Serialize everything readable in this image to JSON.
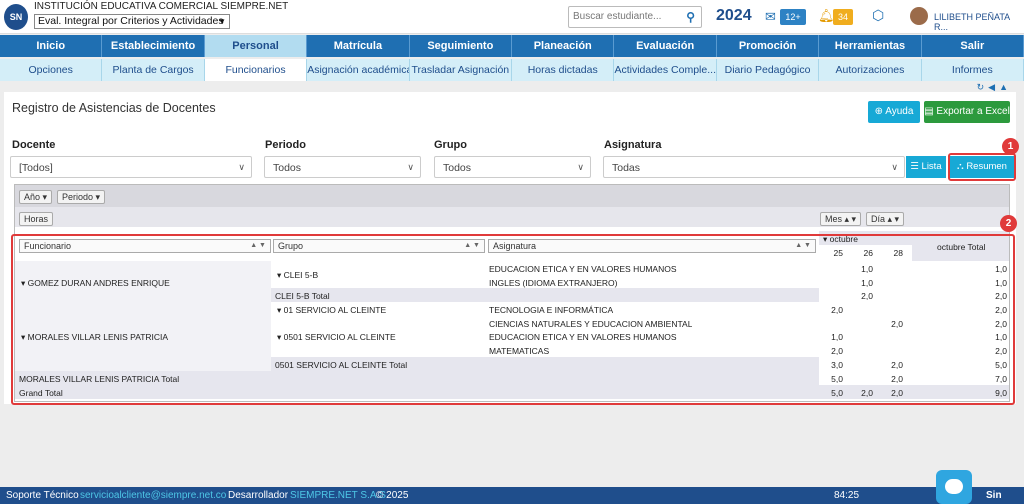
{
  "header": {
    "logo": "SN",
    "institution": "INSTITUCIÓN EDUCATIVA COMERCIAL SIEMPRE.NET",
    "eval_select": "Eval. Integral por Criterios y Actividades",
    "search_placeholder": "Buscar estudiante...",
    "year": "2024",
    "mail_badge": "12+",
    "bell_badge": "34",
    "user_name": "LILIBETH PEÑATA R..."
  },
  "nav_main": [
    "Inicio",
    "Establecimiento",
    "Personal",
    "Matrícula",
    "Seguimiento",
    "Planeación",
    "Evaluación",
    "Promoción",
    "Herramientas",
    "Salir"
  ],
  "nav_sub": [
    "Opciones",
    "Planta de Cargos",
    "Funcionarios",
    "Asignación académica",
    "Trasladar Asignación",
    "Horas dictadas",
    "Actividades Comple... ▾",
    "Diario Pedagógico",
    "Autorizaciones",
    "Informes"
  ],
  "page": {
    "title": "Registro de Asistencias de Docentes",
    "btn_help": "Ayuda",
    "btn_excel": "Exportar a Excel"
  },
  "filters": {
    "docente_label": "Docente",
    "docente_value": "[Todos]",
    "periodo_label": "Periodo",
    "periodo_value": "Todos",
    "grupo_label": "Grupo",
    "grupo_value": "Todos",
    "asignatura_label": "Asignatura",
    "asignatura_value": "Todas",
    "btn_lista": "Lista",
    "btn_resumen": "Resumen"
  },
  "callouts": [
    "1",
    "2"
  ],
  "pivot": {
    "chips": [
      "Año",
      "Periodo",
      "Horas",
      "Mes",
      "Día"
    ],
    "row_fields": [
      "Funcionario",
      "Grupo",
      "Asignatura"
    ],
    "month": "octubre",
    "days": [
      "25",
      "26",
      "28"
    ],
    "month_total": "octubre Total",
    "people": [
      "GOMEZ DURAN ANDRES ENRIQUE",
      "MORALES VILLAR LENIS PATRICIA"
    ],
    "groups": [
      "CLEI 5-B",
      "CLEI 5-B Total",
      "01 SERVICIO AL CLEINTE",
      "0501 SERVICIO AL CLEINTE",
      "0501 SERVICIO AL CLEINTE Total"
    ],
    "subjects": [
      "EDUCACION ETICA Y EN VALORES HUMANOS",
      "INGLES (IDIOMA EXTRANJERO)",
      "TECNOLOGIA E INFORMÁTICA",
      "CIENCIAS NATURALES Y EDUCACION AMBIENTAL",
      "EDUCACION ETICA Y EN VALORES HUMANOS",
      "MATEMATICAS"
    ],
    "person_total": "MORALES VILLAR LENIS PATRICIA Total",
    "grand_total": "Grand Total",
    "rows": [
      [
        "",
        "1,0",
        "",
        "1,0"
      ],
      [
        "",
        "1,0",
        "",
        "1,0"
      ],
      [
        "",
        "2,0",
        "",
        "2,0"
      ],
      [
        "2,0",
        "",
        "",
        "2,0"
      ],
      [
        "",
        "",
        "2,0",
        "2,0"
      ],
      [
        "1,0",
        "",
        "",
        "1,0"
      ],
      [
        "2,0",
        "",
        "",
        "2,0"
      ],
      [
        "3,0",
        "",
        "2,0",
        "5,0"
      ],
      [
        "5,0",
        "",
        "2,0",
        "7,0"
      ],
      [
        "5,0",
        "2,0",
        "2,0",
        "9,0"
      ]
    ]
  },
  "footer": {
    "support_label": "Soporte Técnico",
    "support_email": "servicioalcliente@siempre.net.co",
    "dev_label": "Desarrollador",
    "dev_name": "SIEMPRE.NET S.A.S",
    "copyright": "© 2025",
    "time": "84:25",
    "brand": "Sin"
  }
}
